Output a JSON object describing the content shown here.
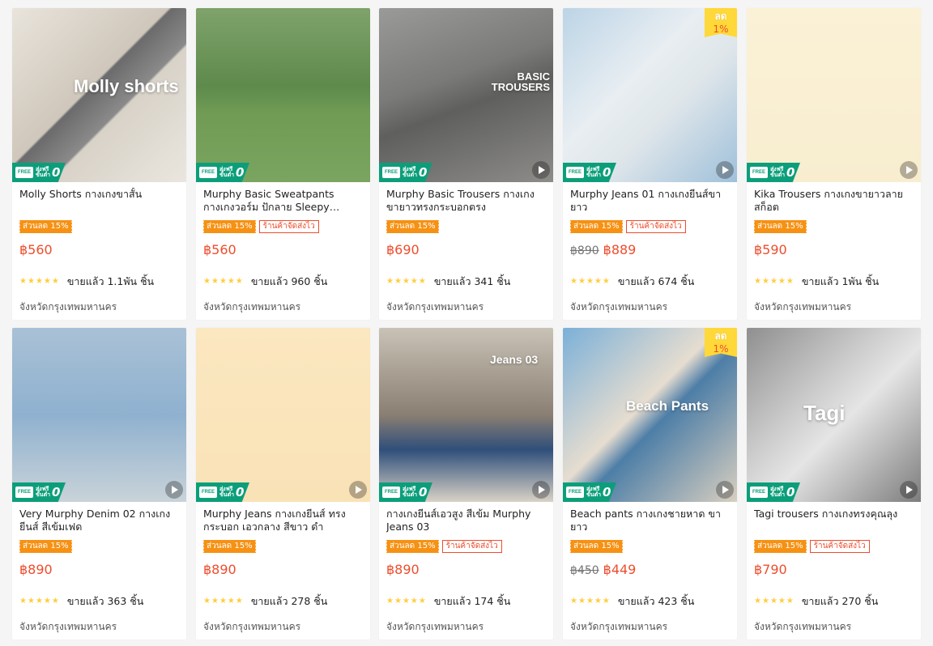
{
  "theme": {
    "price_color": "#ee4d2d",
    "discount_tag_color": "#f69113",
    "free_ship_color": "#0c9e7a",
    "star_color": "#ffce3d"
  },
  "badges": {
    "free_label_top": "FREE",
    "free_label_mid": "ส่งฟรี",
    "free_label_sub": "ขั้นต่ำ",
    "free_zero": "0",
    "discount_flag_label": "ลด",
    "discount_flag_value": "1%"
  },
  "products": [
    {
      "title": "Molly Shorts กางเกงขาสั้น",
      "discount_tag": "ส่วนลด 15%",
      "fast_tag": "",
      "old_price": "",
      "price": "฿560",
      "sold": "ขายแล้ว 1.1พัน ชิ้น",
      "location": "จังหวัดกรุงเทพมหานคร",
      "overlay_text": "Molly shorts",
      "has_video": false,
      "has_flag": false
    },
    {
      "title": "Murphy Basic Sweatpants กางเกงวอร์ม ปักลาย Sleepy…",
      "discount_tag": "ส่วนลด 15%",
      "fast_tag": "ร้านค้าจัดส่งไว",
      "old_price": "",
      "price": "฿560",
      "sold": "ขายแล้ว 960 ชิ้น",
      "location": "จังหวัดกรุงเทพมหานคร",
      "overlay_text": "",
      "has_video": false,
      "has_flag": false
    },
    {
      "title": "Murphy Basic Trousers กางเกงขายาวทรงกระบอกตรง",
      "discount_tag": "ส่วนลด 15%",
      "fast_tag": "",
      "old_price": "",
      "price": "฿690",
      "sold": "ขายแล้ว 341 ชิ้น",
      "location": "จังหวัดกรุงเทพมหานคร",
      "overlay_text": "BASIC TROUSERS",
      "has_video": true,
      "has_flag": false
    },
    {
      "title": "Murphy Jeans 01 กางเกงยีนส์ขายาว",
      "discount_tag": "ส่วนลด 15%",
      "fast_tag": "ร้านค้าจัดส่งไว",
      "old_price": "฿890",
      "price": "฿889",
      "sold": "ขายแล้ว 674 ชิ้น",
      "location": "จังหวัดกรุงเทพมหานคร",
      "overlay_text": "",
      "has_video": true,
      "has_flag": true
    },
    {
      "title": "Kika Trousers กางเกงขายาวลายสก็อต",
      "discount_tag": "ส่วนลด 15%",
      "fast_tag": "",
      "old_price": "",
      "price": "฿590",
      "sold": "ขายแล้ว 1พัน ชิ้น",
      "location": "จังหวัดกรุงเทพมหานคร",
      "overlay_text": "",
      "has_video": true,
      "has_flag": false
    },
    {
      "title": "Very Murphy Denim 02 กางเกงยีนส์ สีเข้มเฟด",
      "discount_tag": "ส่วนลด 15%",
      "fast_tag": "",
      "old_price": "",
      "price": "฿890",
      "sold": "ขายแล้ว 363 ชิ้น",
      "location": "จังหวัดกรุงเทพมหานคร",
      "overlay_text": "",
      "has_video": true,
      "has_flag": false
    },
    {
      "title": "Murphy Jeans กางเกงยีนส์ ทรงกระบอก เอวกลาง สีขาว ดำ",
      "discount_tag": "ส่วนลด 15%",
      "fast_tag": "",
      "old_price": "",
      "price": "฿890",
      "sold": "ขายแล้ว 278 ชิ้น",
      "location": "จังหวัดกรุงเทพมหานคร",
      "overlay_text": "",
      "has_video": true,
      "has_flag": false
    },
    {
      "title": "กางเกงยีนส์เอวสูง สีเข้ม Murphy Jeans 03",
      "discount_tag": "ส่วนลด 15%",
      "fast_tag": "ร้านค้าจัดส่งไว",
      "old_price": "",
      "price": "฿890",
      "sold": "ขายแล้ว 174 ชิ้น",
      "location": "จังหวัดกรุงเทพมหานคร",
      "overlay_text": "Jeans 03",
      "has_video": true,
      "has_flag": false
    },
    {
      "title": "Beach pants กางเกงชายหาด ขายาว",
      "discount_tag": "ส่วนลด 15%",
      "fast_tag": "",
      "old_price": "฿450",
      "price": "฿449",
      "sold": "ขายแล้ว 423 ชิ้น",
      "location": "จังหวัดกรุงเทพมหานคร",
      "overlay_text": "Beach Pants",
      "has_video": true,
      "has_flag": true
    },
    {
      "title": "Tagi trousers กางเกงทรงคุณลุง",
      "discount_tag": "ส่วนลด 15%",
      "fast_tag": "ร้านค้าจัดส่งไว",
      "old_price": "",
      "price": "฿790",
      "sold": "ขายแล้ว 270 ชิ้น",
      "location": "จังหวัดกรุงเทพมหานคร",
      "overlay_text": "Tagi",
      "has_video": true,
      "has_flag": false
    }
  ]
}
